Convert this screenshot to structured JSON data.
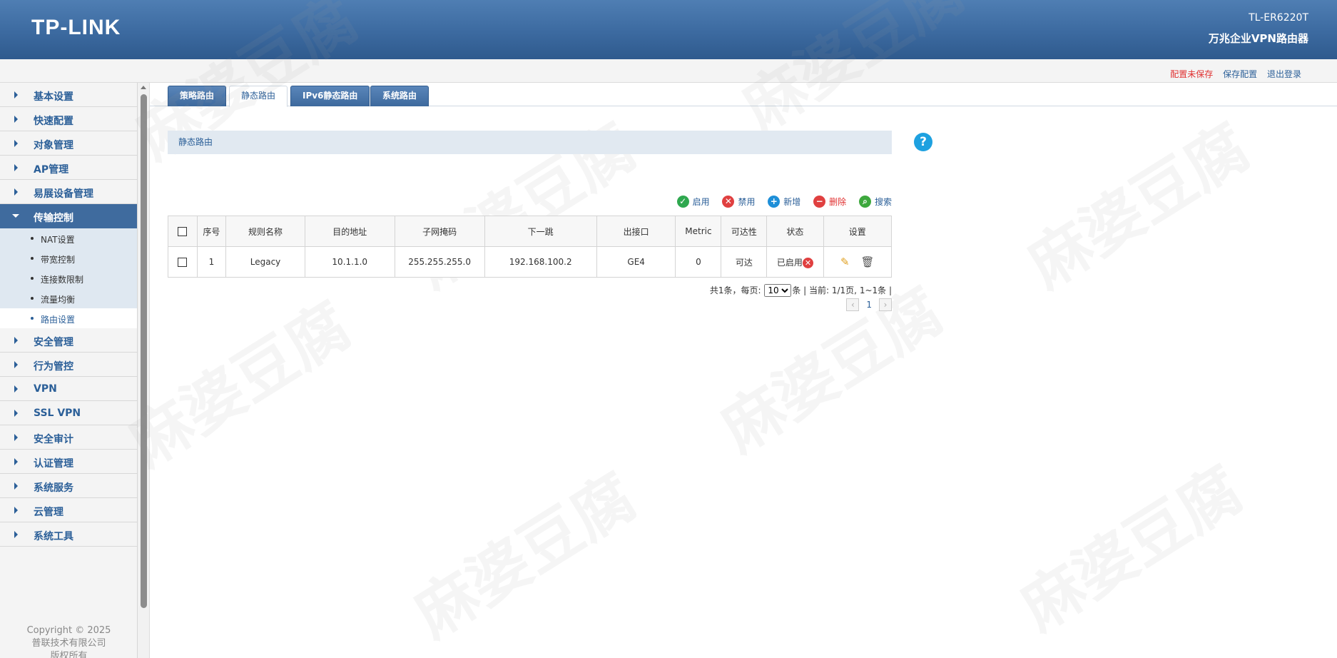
{
  "header": {
    "logo": "TP-LINK",
    "model": "TL-ER6220T",
    "subtitle": "万兆企业VPN路由器"
  },
  "topbar": {
    "unsaved": "配置未保存",
    "save": "保存配置",
    "logout": "退出登录"
  },
  "sidebar": {
    "items_top": [
      {
        "label": "基本设置"
      },
      {
        "label": "快速配置"
      },
      {
        "label": "对象管理"
      },
      {
        "label": "AP管理"
      },
      {
        "label": "易展设备管理"
      }
    ],
    "active": {
      "label": "传输控制"
    },
    "subitems": [
      {
        "label": "NAT设置"
      },
      {
        "label": "带宽控制"
      },
      {
        "label": "连接数限制"
      },
      {
        "label": "流量均衡"
      },
      {
        "label": "路由设置"
      }
    ],
    "items_bottom": [
      {
        "label": "安全管理"
      },
      {
        "label": "行为管控"
      },
      {
        "label": "VPN"
      },
      {
        "label": "SSL VPN"
      },
      {
        "label": "安全审计"
      },
      {
        "label": "认证管理"
      },
      {
        "label": "系统服务"
      },
      {
        "label": "云管理"
      },
      {
        "label": "系统工具"
      }
    ],
    "copyright": [
      "Copyright © 2025",
      "普联技术有限公司",
      "版权所有"
    ]
  },
  "tabs": [
    {
      "label": "策略路由"
    },
    {
      "label": "静态路由"
    },
    {
      "label": "IPv6静态路由"
    },
    {
      "label": "系统路由"
    }
  ],
  "section_title": "静态路由",
  "toolbar": {
    "enable": "启用",
    "disable": "禁用",
    "add": "新增",
    "delete": "删除",
    "search": "搜索"
  },
  "table": {
    "headers": [
      "序号",
      "规则名称",
      "目的地址",
      "子网掩码",
      "下一跳",
      "出接口",
      "Metric",
      "可达性",
      "状态",
      "设置"
    ],
    "rows": [
      {
        "index": "1",
        "name": "Legacy",
        "dest": "10.1.1.0",
        "mask": "255.255.255.0",
        "next_hop": "192.168.100.2",
        "iface": "GE4",
        "metric": "0",
        "reachable": "可达",
        "status": "已启用"
      }
    ]
  },
  "pager": {
    "prefix": "共1条，每页:",
    "page_size": "10",
    "suffix": "条 | 当前: 1/1页, 1~1条 |",
    "current_page": "1"
  },
  "watermark": "麻婆豆腐",
  "colors": {
    "header_blue": "#3c6aa0",
    "link_blue": "#2b5f98",
    "warning_red": "#e03030",
    "enable_green": "#2fa84f",
    "help_blue": "#1ea1e0"
  }
}
